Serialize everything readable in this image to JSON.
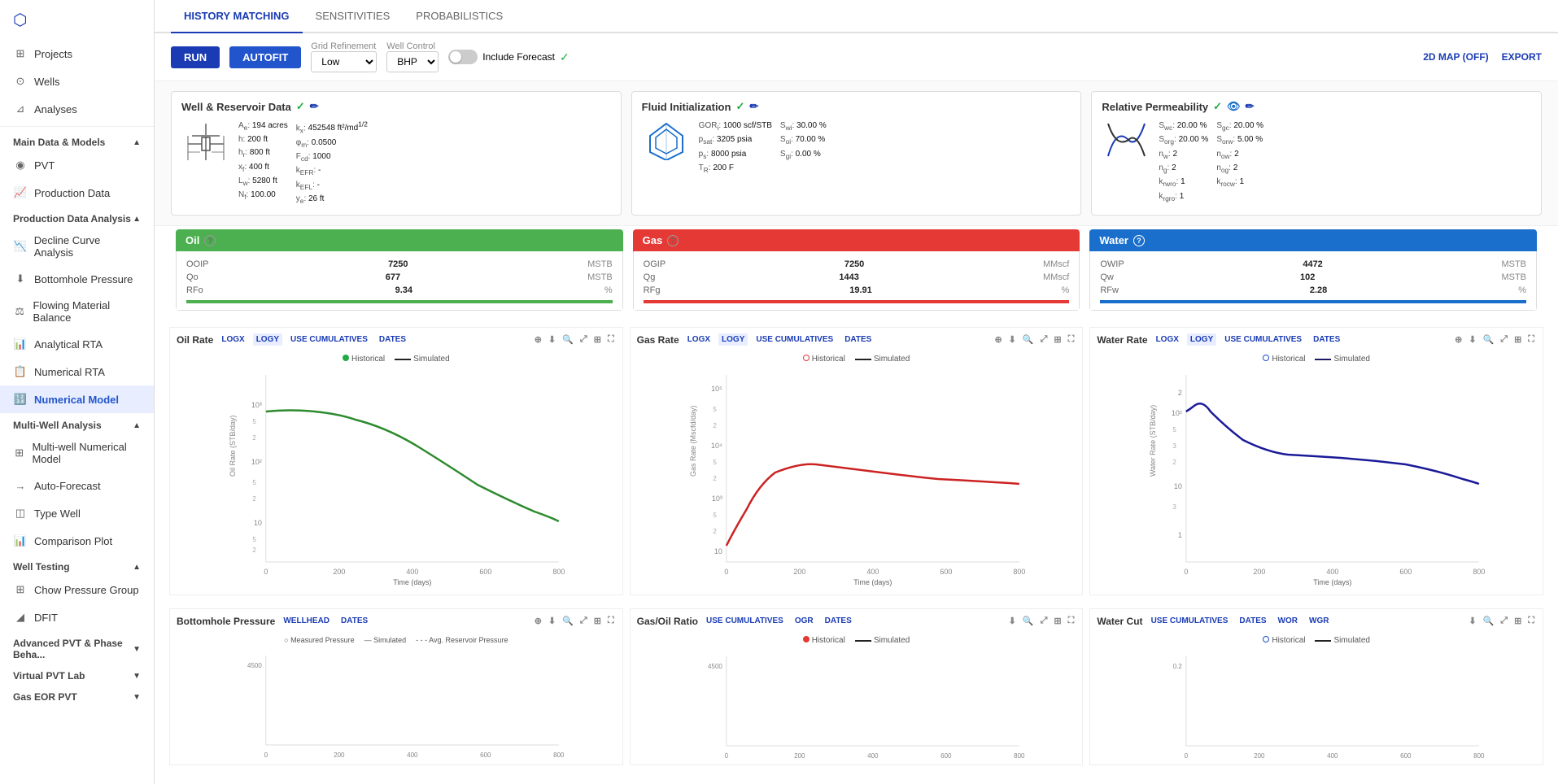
{
  "sidebar": {
    "top_items": [
      {
        "id": "projects",
        "label": "Projects",
        "icon": "⊞"
      },
      {
        "id": "wells",
        "label": "Wells",
        "icon": "⊙"
      },
      {
        "id": "analyses",
        "label": "Analyses",
        "icon": "⊿"
      }
    ],
    "sections": [
      {
        "id": "main-data-models",
        "label": "Main Data & Models",
        "expanded": true,
        "items": [
          {
            "id": "pvt",
            "label": "PVT",
            "icon": "◉"
          },
          {
            "id": "production-data",
            "label": "Production Data",
            "icon": "📈"
          }
        ]
      },
      {
        "id": "production-data-analysis",
        "label": "Production Data Analysis",
        "expanded": true,
        "items": [
          {
            "id": "decline-curve",
            "label": "Decline Curve Analysis",
            "icon": "📉"
          },
          {
            "id": "bottomhole-pressure",
            "label": "Bottomhole Pressure",
            "icon": "⬇"
          },
          {
            "id": "flowing-material",
            "label": "Flowing Material Balance",
            "icon": "⚖"
          },
          {
            "id": "analytical-rta",
            "label": "Analytical RTA",
            "icon": "📊"
          },
          {
            "id": "numerical-rta",
            "label": "Numerical RTA",
            "icon": "📋"
          },
          {
            "id": "numerical-model",
            "label": "Numerical Model",
            "icon": "🔢",
            "active": true
          }
        ]
      },
      {
        "id": "multi-well",
        "label": "Multi-Well Analysis",
        "expanded": true,
        "items": [
          {
            "id": "multi-well-model",
            "label": "Multi-well Numerical Model",
            "icon": "⊞"
          },
          {
            "id": "auto-forecast",
            "label": "Auto-Forecast",
            "icon": "→"
          },
          {
            "id": "type-well",
            "label": "Type Well",
            "icon": "◫"
          },
          {
            "id": "comparison-plot",
            "label": "Comparison Plot",
            "icon": "📊"
          }
        ]
      },
      {
        "id": "well-testing",
        "label": "Well Testing",
        "expanded": true,
        "items": [
          {
            "id": "chow-pressure",
            "label": "Chow Pressure Group",
            "icon": "⊞"
          },
          {
            "id": "dfit",
            "label": "DFIT",
            "icon": "◢"
          }
        ]
      },
      {
        "id": "advanced-pvt",
        "label": "Advanced PVT & Phase Beha...",
        "expanded": false,
        "items": []
      },
      {
        "id": "virtual-pvt",
        "label": "Virtual PVT Lab",
        "expanded": false,
        "items": []
      },
      {
        "id": "gas-eor",
        "label": "Gas EOR PVT",
        "expanded": false,
        "items": []
      }
    ]
  },
  "tabs": [
    {
      "id": "history-matching",
      "label": "HISTORY MATCHING",
      "active": true
    },
    {
      "id": "sensitivities",
      "label": "SENSITIVITIES",
      "active": false
    },
    {
      "id": "probabilistics",
      "label": "PROBABILISTICS",
      "active": false
    }
  ],
  "toolbar": {
    "run_label": "RUN",
    "autofit_label": "AUTOFIT",
    "grid_refinement_label": "Grid Refinement",
    "grid_refinement_value": "Low",
    "well_control_label": "Well Control",
    "well_control_value": "BHP",
    "include_forecast_label": "Include Forecast",
    "map_label": "2D MAP (OFF)",
    "export_label": "EXPORT"
  },
  "cards": {
    "well_reservoir": {
      "title": "Well & Reservoir Data",
      "params_left": [
        {
          "key": "A_e:",
          "value": "194 acres"
        },
        {
          "key": "h:",
          "value": "200 ft"
        },
        {
          "key": "h_r:",
          "value": "800 ft"
        },
        {
          "key": "x_f:",
          "value": "400 ft"
        },
        {
          "key": "L_w:",
          "value": "5280 ft"
        },
        {
          "key": "N_f:",
          "value": "100.00"
        }
      ],
      "params_right": [
        {
          "key": "k_x:",
          "value": "452548 ft²/md^1/2"
        },
        {
          "key": "φ_m:",
          "value": "0.0500"
        },
        {
          "key": "F_cd:",
          "value": "1000"
        },
        {
          "key": "k_EFR:",
          "value": "-"
        },
        {
          "key": "k_EFL:",
          "value": "-"
        },
        {
          "key": "y_e:",
          "value": "26 ft"
        }
      ]
    },
    "fluid_init": {
      "title": "Fluid Initialization",
      "params": [
        {
          "key": "GOR_i:",
          "value": "1000 scf/STB"
        },
        {
          "key": "p_sat:",
          "value": "3205 psia"
        },
        {
          "key": "p_s:",
          "value": "8000 psia"
        },
        {
          "key": "T_R:",
          "value": "200 F"
        }
      ],
      "params_right": [
        {
          "key": "S_wi:",
          "value": "30.00 %"
        },
        {
          "key": "S_oi:",
          "value": "70.00 %"
        },
        {
          "key": "S_gi:",
          "value": "0.00 %"
        }
      ]
    },
    "rel_perm": {
      "title": "Relative Permeability",
      "params_left": [
        {
          "key": "S_wc:",
          "value": "20.00 %"
        },
        {
          "key": "S_org:",
          "value": "20.00 %"
        },
        {
          "key": "n_w:",
          "value": "2"
        },
        {
          "key": "n_g:",
          "value": "2"
        },
        {
          "key": "k_rwro:",
          "value": "1"
        },
        {
          "key": "k_rgro:",
          "value": "1"
        }
      ],
      "params_right": [
        {
          "key": "S_gc:",
          "value": "20.00 %"
        },
        {
          "key": "S_orw:",
          "value": "5.00 %"
        },
        {
          "key": "n_ow:",
          "value": "2"
        },
        {
          "key": "n_og:",
          "value": "2"
        },
        {
          "key": "k_rocw:",
          "value": "1"
        }
      ]
    }
  },
  "phases": {
    "oil": {
      "label": "Oil",
      "ooip_label": "OOIP",
      "ooip_value": "7250",
      "ooip_unit": "MSTB",
      "qo_label": "Qo",
      "qo_value": "677",
      "qo_unit": "MSTB",
      "rfo_label": "RFo",
      "rfo_value": "9.34",
      "rfo_unit": "%"
    },
    "gas": {
      "label": "Gas",
      "ogip_label": "OGIP",
      "ogip_value": "7250",
      "ogip_unit": "MMscf",
      "qg_label": "Qg",
      "qg_value": "1443",
      "qg_unit": "MMscf",
      "rfg_label": "RFg",
      "rfg_value": "19.91",
      "rfg_unit": "%"
    },
    "water": {
      "label": "Water",
      "owip_label": "OWIP",
      "owip_value": "4472",
      "owip_unit": "MSTB",
      "qw_label": "Qw",
      "qw_value": "102",
      "qw_unit": "MSTB",
      "rfw_label": "RFw",
      "rfw_value": "2.28",
      "rfw_unit": "%"
    }
  },
  "charts": {
    "oil_rate": {
      "title": "Oil Rate",
      "y_label": "Oil Rate (STB/day)",
      "x_label": "Time (days)",
      "tabs": [
        "LOGX",
        "LOGY",
        "USE CUMULATIVES",
        "DATES"
      ],
      "active_tab": "LOGY",
      "legend_historical": "Historical",
      "legend_simulated": "Simulated",
      "color": "#2d8a2d"
    },
    "gas_rate": {
      "title": "Gas Rate",
      "y_label": "Gas Rate (Mscfd/day)",
      "x_label": "Time (days)",
      "tabs": [
        "LOGX",
        "LOGY",
        "USE CUMULATIVES",
        "DATES"
      ],
      "active_tab": "LOGY",
      "legend_historical": "Historical",
      "legend_simulated": "Simulated",
      "color": "#cc2222"
    },
    "water_rate": {
      "title": "Water Rate",
      "y_label": "Water Rate (STB/day)",
      "x_label": "Time (days)",
      "tabs": [
        "LOGX",
        "LOGY",
        "USE CUMULATIVES",
        "DATES"
      ],
      "active_tab": "LOGY",
      "legend_historical": "Historical",
      "legend_simulated": "Simulated",
      "color": "#1a4fcc"
    },
    "bhp": {
      "title": "Bottomhole Pressure",
      "tabs": [
        "WELLHEAD",
        "DATES"
      ],
      "legend_measured": "Measured Pressure",
      "legend_simulated": "Simulated",
      "legend_avg": "Avg. Reservoir Pressure"
    },
    "gor": {
      "title": "Gas/Oil Ratio",
      "tabs": [
        "USE CUMULATIVES",
        "OGR",
        "DATES"
      ],
      "legend_historical": "Historical",
      "legend_simulated": "Simulated"
    },
    "water_cut": {
      "title": "Water Cut",
      "tabs": [
        "USE CUMULATIVES",
        "DATES",
        "WOR",
        "WGR"
      ],
      "legend_historical": "Historical",
      "legend_simulated": "Simulated"
    }
  }
}
